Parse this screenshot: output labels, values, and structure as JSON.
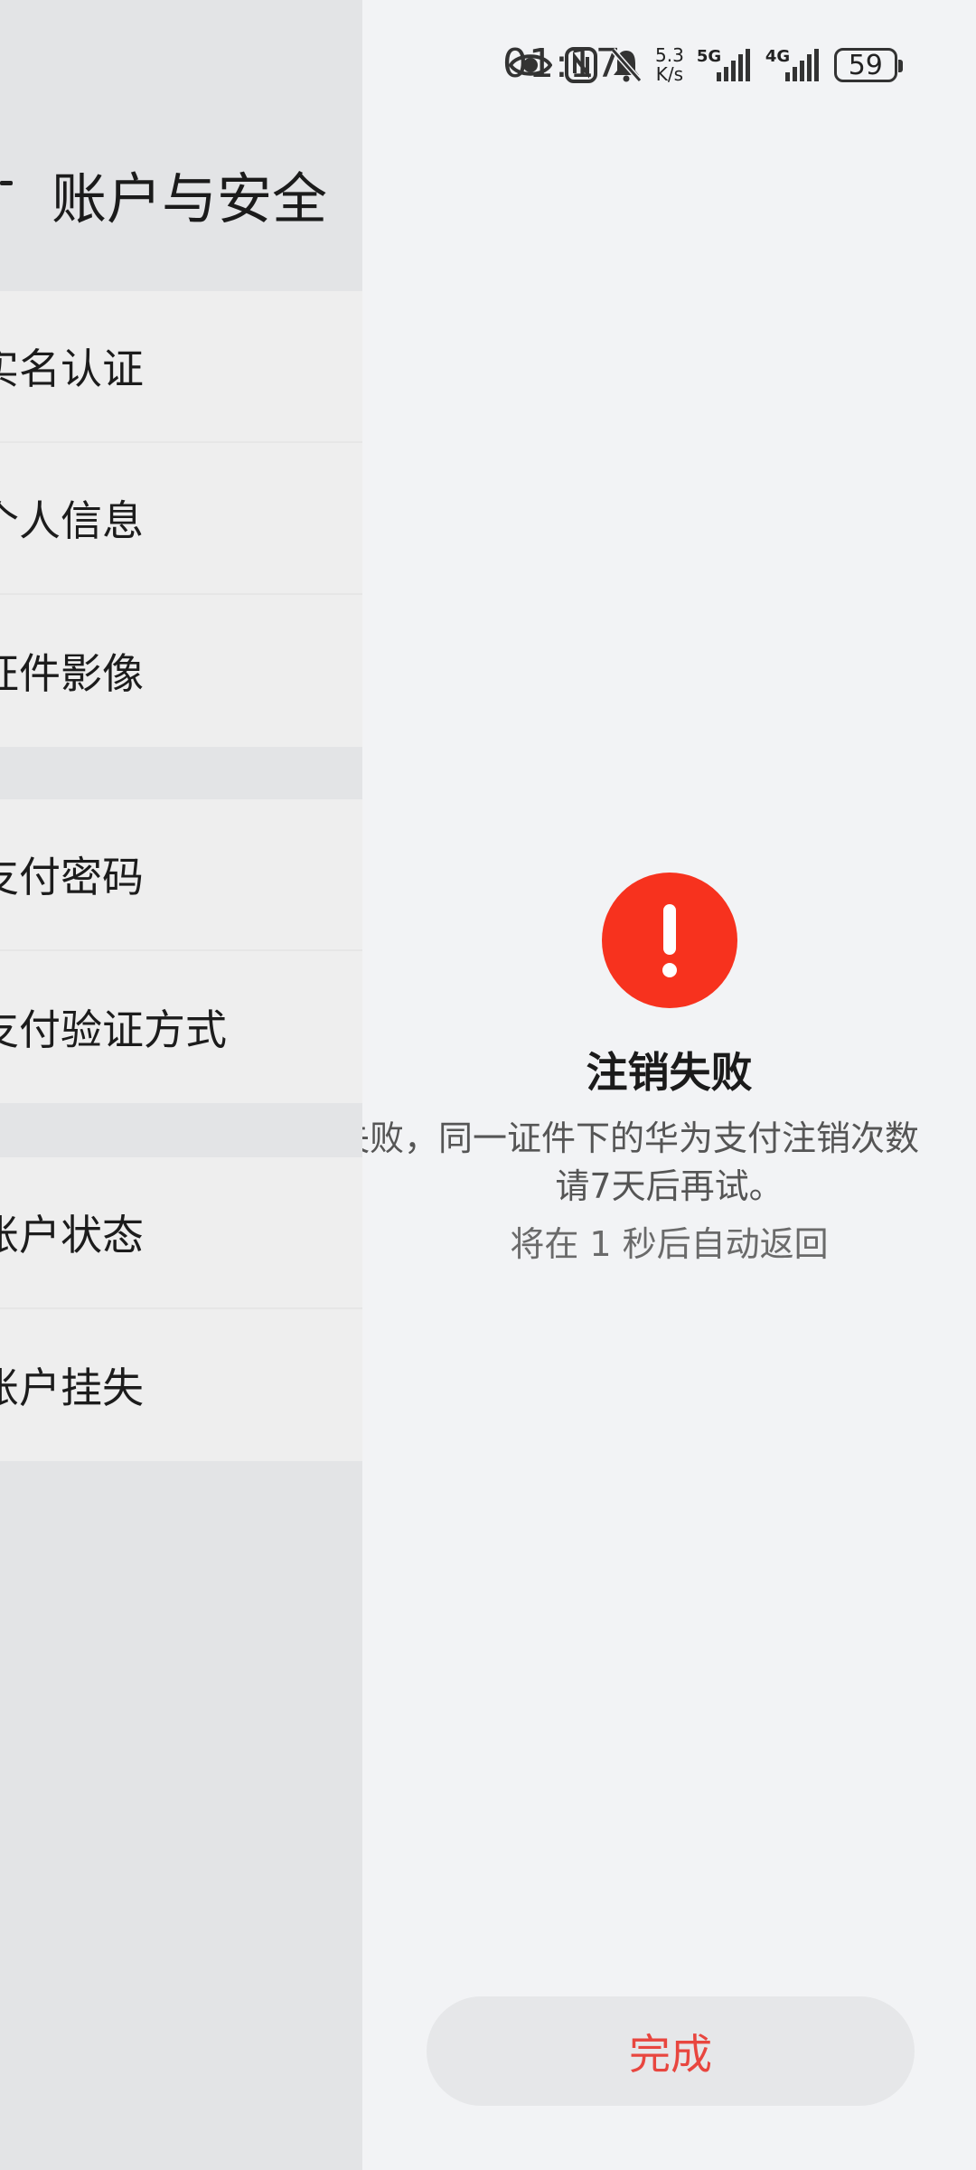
{
  "status_bar": {
    "time": "01:17",
    "net_speed_value": "5.3",
    "net_speed_unit": "K/s",
    "sim1_label": "5G",
    "sim2_label": "4G",
    "battery": "59"
  },
  "left_page": {
    "title": "账户与安全",
    "groups": [
      {
        "items": [
          "实名认证",
          "个人信息",
          "证件影像"
        ]
      },
      {
        "items": [
          "支付密码",
          "支付验证方式"
        ]
      },
      {
        "items": [
          "账户状态",
          "账户挂失"
        ]
      }
    ]
  },
  "result": {
    "title": "注销失败",
    "message_line1": "失败，同一证件下的华为支付注销次数",
    "message_line2": "请7天后再试。",
    "countdown": "将在 1 秒后自动返回",
    "done_label": "完成"
  },
  "colors": {
    "error_red": "#f7321e",
    "button_text": "#e8463f",
    "background": "#f2f3f5"
  }
}
